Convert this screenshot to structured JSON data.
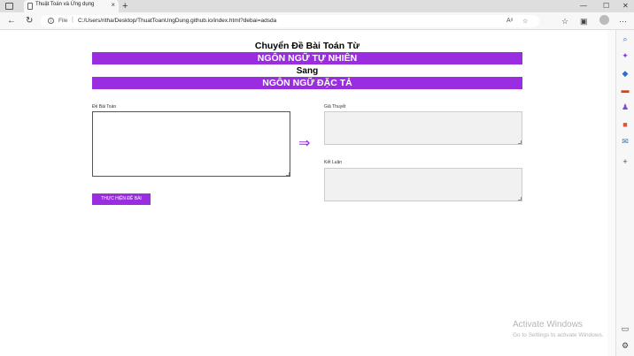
{
  "browser": {
    "tab_title": "Thuật Toán và Ứng dụng",
    "tab_close": "×",
    "new_tab": "+",
    "minimize": "—",
    "maximize": "☐",
    "close": "✕",
    "back": "←",
    "refresh": "↻",
    "file_label": "File",
    "url_separator": "|",
    "url": "C:/Users/ritha/Desktop/ThuatToanUngDung.github.io/index.html?debai=adsda"
  },
  "page": {
    "heading": "Chuyển Đề Bài Toán Từ",
    "band_1": "NGÔN NGỮ TỰ NHIÊN",
    "middle": "Sang",
    "band_2": "NGÔN NGỮ ĐẶC TẢ",
    "problem_label": "Đề Bài Toán",
    "hypothesis_label": "Giả Thuyết",
    "conclusion_label": "Kết Luận",
    "arrow": "⇒",
    "submit_label": "THỰC HIỆN ĐỀ BÀI",
    "problem_value": "",
    "hypothesis_value": "",
    "conclusion_value": ""
  },
  "watermark": {
    "title": "Activate Windows",
    "subtitle": "Go to Settings to activate Windows."
  },
  "colors": {
    "accent": "#9a2de0"
  }
}
